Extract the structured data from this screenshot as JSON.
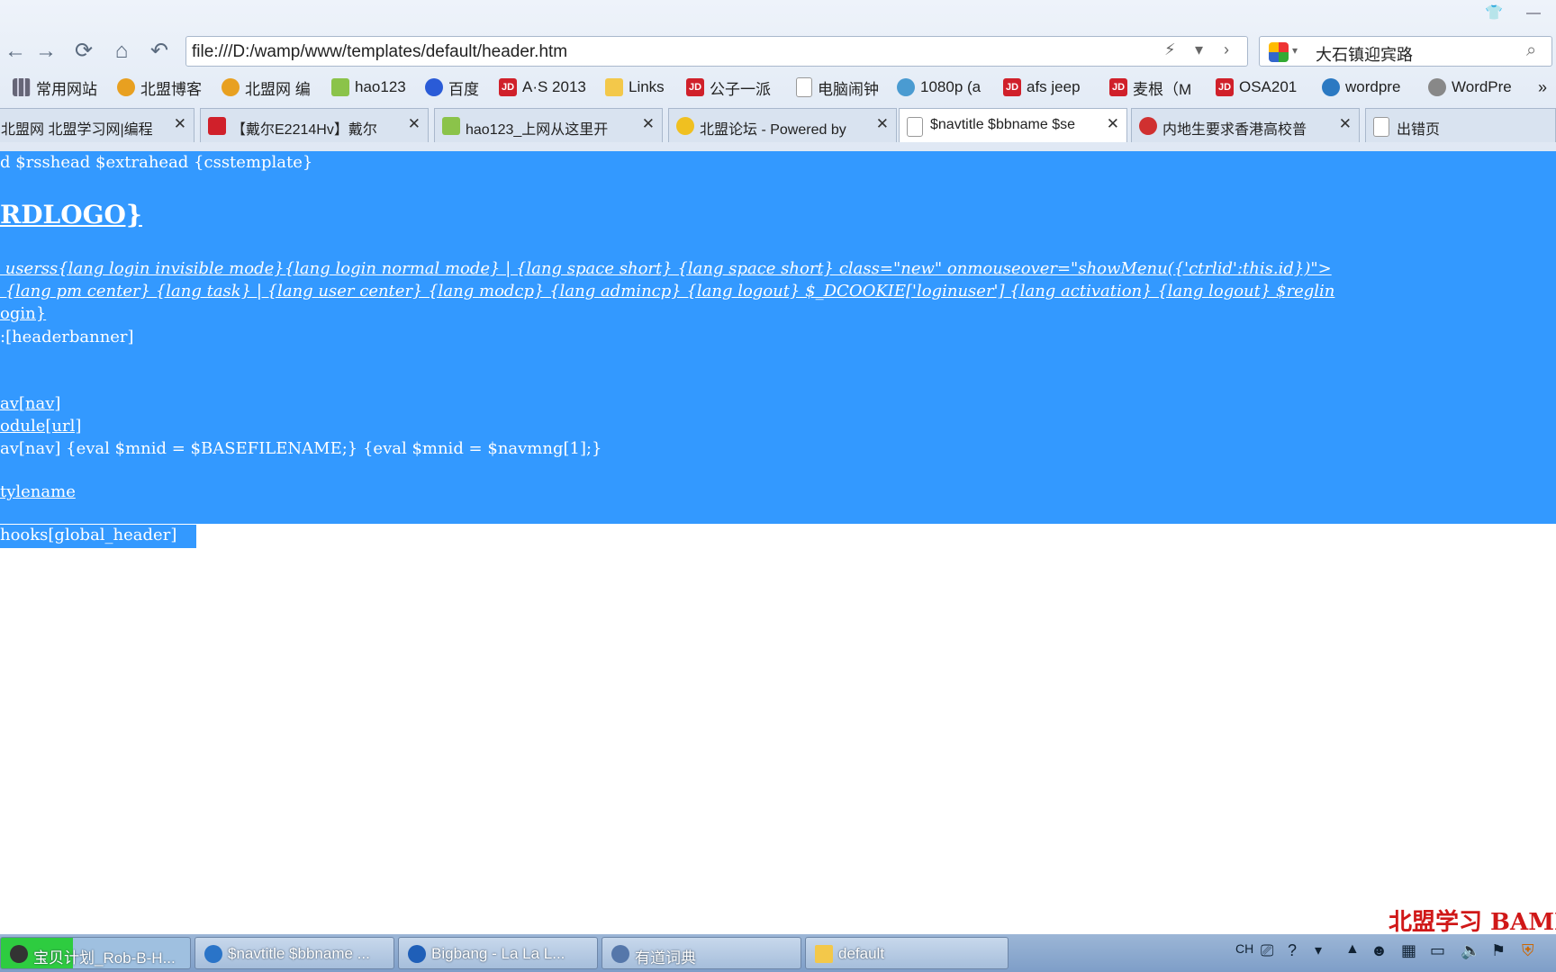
{
  "window": {
    "buttons": [
      "shirt",
      "minimize"
    ]
  },
  "nav": {
    "url": "file:///D:/wamp/www/templates/default/header.htm",
    "search_value": "大石镇迎宾路"
  },
  "bookmarks": [
    {
      "label": "常用网站",
      "icon": "grid-icon"
    },
    {
      "label": "北盟博客",
      "icon": "bird-icon"
    },
    {
      "label": "北盟网 编",
      "icon": "bird-icon"
    },
    {
      "label": "hao123",
      "icon": "hao123-icon"
    },
    {
      "label": "百度",
      "icon": "baidu-paw-icon"
    },
    {
      "label": "A·S 2013",
      "icon": "jd-icon"
    },
    {
      "label": "Links",
      "icon": "folder-icon"
    },
    {
      "label": "公子一派",
      "icon": "jd-icon"
    },
    {
      "label": "电脑闹钟",
      "icon": "page-icon"
    },
    {
      "label": "1080p (a",
      "icon": "gear-icon"
    },
    {
      "label": "afs jeep",
      "icon": "jd-icon"
    },
    {
      "label": "麦根（M",
      "icon": "jd-icon"
    },
    {
      "label": "OSA201",
      "icon": "jd-icon"
    },
    {
      "label": "wordpre",
      "icon": "wordpress-icon"
    },
    {
      "label": "WordPre",
      "icon": "wordpress-icon"
    }
  ],
  "tabs": [
    {
      "label": "北盟网 北盟学习网|编程",
      "active": false
    },
    {
      "label": "【戴尔E2214Hv】戴尔",
      "active": false
    },
    {
      "label": "hao123_上网从这里开",
      "active": false
    },
    {
      "label": "北盟论坛 - Powered by",
      "active": false
    },
    {
      "label": "$navtitle $bbname $se",
      "active": true
    },
    {
      "label": "内地生要求香港高校普",
      "active": false
    },
    {
      "label": "出错页",
      "active": false
    }
  ],
  "content": {
    "lines": [
      "d $rsshead $extrahead {csstemplate}",
      "RDLOGO}",
      " userss{lang login invisible mode}{lang login normal mode} | {lang space short} {lang space short} class=\"new\" onmouseover=\"showMenu({'ctrlid':this.id})\">",
      " {lang pm center} {lang task} | {lang user center} {lang modcp} {lang admincp} {lang logout} $_DCOOKIE['loginuser'] {lang activation} {lang logout} $reglin",
      "ogin}",
      ":[headerbanner]",
      "av[nav]",
      "odule[url]",
      "av[nav] {eval $mnid = $BASEFILENAME;} {eval $mnid = $navmng[1];}",
      "tylename",
      "hooks[global_header]"
    ],
    "watermark": "北盟学习 BAMN"
  },
  "taskbar": {
    "tasks": [
      {
        "label": "宝贝计划_Rob-B-H..."
      },
      {
        "label": "$navtitle $bbname ..."
      },
      {
        "label": "Bigbang - La La L..."
      },
      {
        "label": "有道词典"
      },
      {
        "label": "default"
      }
    ],
    "tray_lang": "CH"
  }
}
